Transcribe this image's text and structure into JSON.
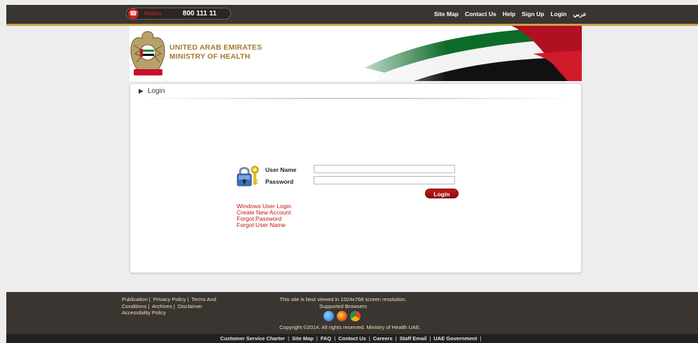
{
  "topbar": {
    "hotline_label": "Hotline",
    "hotline_number": "800 111 11",
    "nav": [
      "Site Map",
      "Contact Us",
      "Help",
      "Sign Up",
      "Login",
      "عربي"
    ]
  },
  "header": {
    "line1": "UNITED ARAB EMIRATES",
    "line2": "MINISTRY OF HEALTH"
  },
  "panel": {
    "title": "Login",
    "username_label": "User Name",
    "password_label": "Password",
    "username_value": "",
    "password_value": "",
    "login_button": "Login",
    "links": [
      "Windows User Login",
      "Create New Account",
      "Forgot Password",
      "Forgot User Name"
    ]
  },
  "footer": {
    "links_line1": [
      "Publication",
      "Privacy Policy",
      "Terms And"
    ],
    "links_line2": [
      "Conditions",
      "Archives",
      "Disclaimer"
    ],
    "links_line3": [
      "Accessibility Policy"
    ],
    "resolution_note": "This site is best viewed in 1024x768 screen resolution.",
    "supported_browsers": "Supported Browsers",
    "browser_icons": [
      "internet-explorer-icon",
      "firefox-icon",
      "chrome-icon"
    ],
    "copyright": "Copyright ©2014. All rights reserved. Ministry of Health UAE.",
    "bottom_links": [
      "Customer Service Charter",
      "Site Map",
      "FAQ",
      "Contact Us",
      "Careers",
      "Staff Email",
      "UAE Government"
    ]
  },
  "colors": {
    "topbar_bg": "#3a3530",
    "gold": "#c9a24b",
    "accent_red": "#c0161b",
    "ministry_text": "#a47a2c"
  }
}
